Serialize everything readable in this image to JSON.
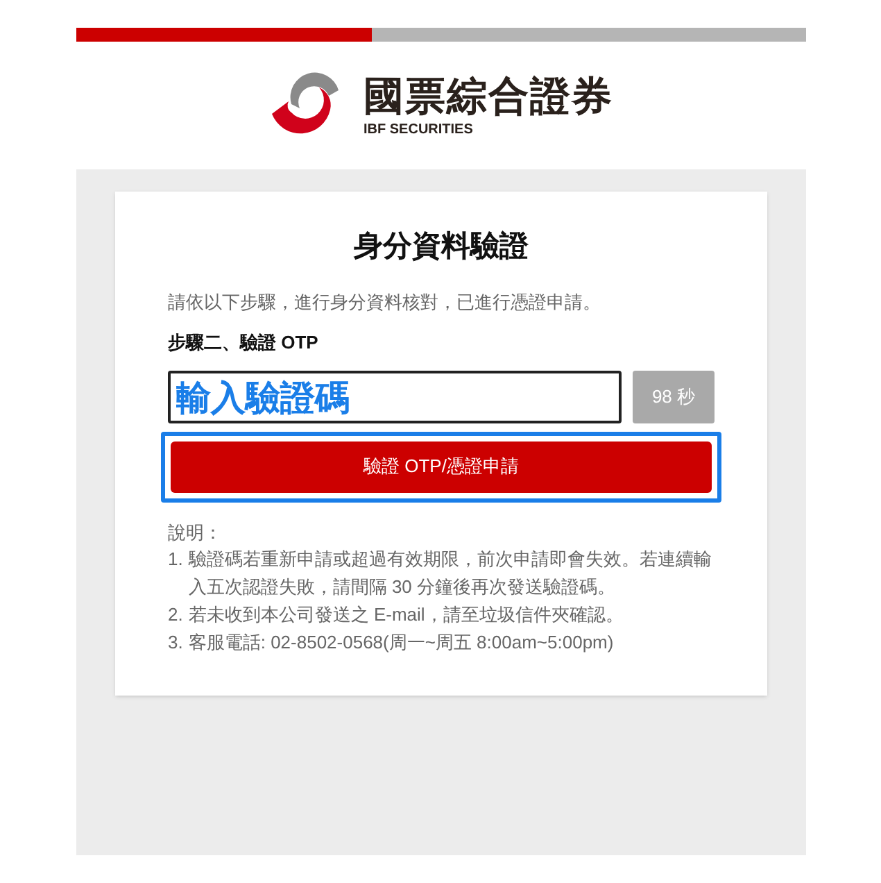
{
  "progress": {
    "level": 0.405
  },
  "logo": {
    "name": "國票綜合證券",
    "subtitle": "IBF SECURITIES"
  },
  "card": {
    "title": "身分資料驗證",
    "intro": "請依以下步驟，進行身分資料核對，已進行憑證申請。",
    "step": "步驟二、驗證 OTP",
    "otp_field": {
      "annotation": "輸入驗證碼"
    },
    "countdown_button": {
      "label": "98 秒",
      "disabled": true
    },
    "submit_button": {
      "label": "驗證 OTP/憑證申請",
      "highlighted": true
    },
    "notes": {
      "heading": "說明：",
      "items": [
        {
          "number": "1.",
          "text": "驗證碼若重新申請或超過有效期限，前次申請即會失效。若連續輸入五次認證失敗，請間隔 30 分鐘後再次發送驗證碼。"
        },
        {
          "number": "2.",
          "text": "若未收到本公司發送之 E-mail，請至垃圾信件夾確認。"
        },
        {
          "number": "3.",
          "text": "客服電話: 02-8502-0568(周一~周五 8:00am~5:00pm)"
        }
      ]
    }
  }
}
